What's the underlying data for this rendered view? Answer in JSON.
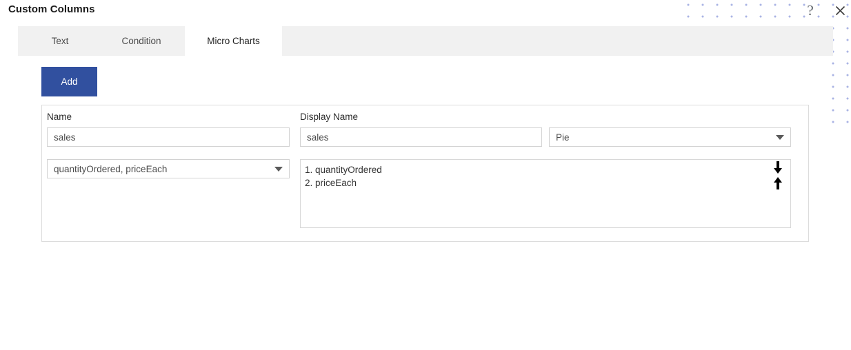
{
  "window": {
    "title": "Custom Columns",
    "help_icon": "question-mark-icon",
    "close_icon": "close-icon"
  },
  "tabs": [
    {
      "label": "Text",
      "active": false
    },
    {
      "label": "Condition",
      "active": false
    },
    {
      "label": "Micro Charts",
      "active": true
    }
  ],
  "toolbar": {
    "add_label": "Add"
  },
  "form": {
    "name_label": "Name",
    "name_value": "sales",
    "display_name_label": "Display Name",
    "display_name_value": "sales",
    "chart_type_value": "Pie",
    "columns_value": "quantityOrdered, priceEach",
    "selected_columns": [
      "1. quantityOrdered",
      "2. priceEach"
    ],
    "move_down_icon": "arrow-down-icon",
    "move_up_icon": "arrow-up-icon"
  },
  "colors": {
    "accent": "#31509f",
    "tabbar_bg": "#f1f1f1",
    "active_tab_bg": "#ffffff",
    "border": "#d2d2d2",
    "dot_pattern": "#aab4e4"
  }
}
